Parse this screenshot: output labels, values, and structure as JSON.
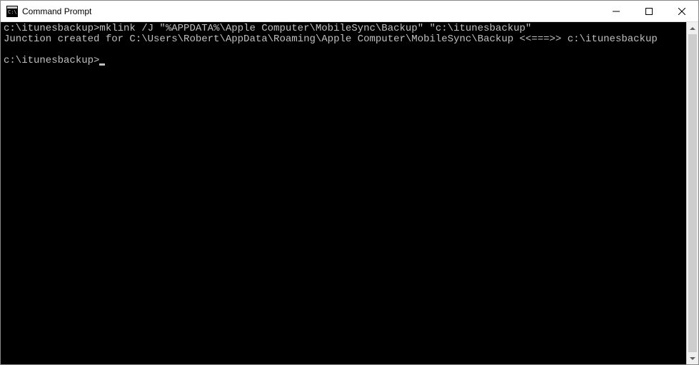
{
  "window": {
    "title": "Command Prompt"
  },
  "terminal": {
    "line1_prompt": "c:\\itunesbackup>",
    "line1_command": "mklink /J \"%APPDATA%\\Apple Computer\\MobileSync\\Backup\" \"c:\\itunesbackup\"",
    "line2": "Junction created for C:\\Users\\Robert\\AppData\\Roaming\\Apple Computer\\MobileSync\\Backup <<===>> c:\\itunesbackup",
    "line3": "",
    "line4_prompt": "c:\\itunesbackup>"
  }
}
